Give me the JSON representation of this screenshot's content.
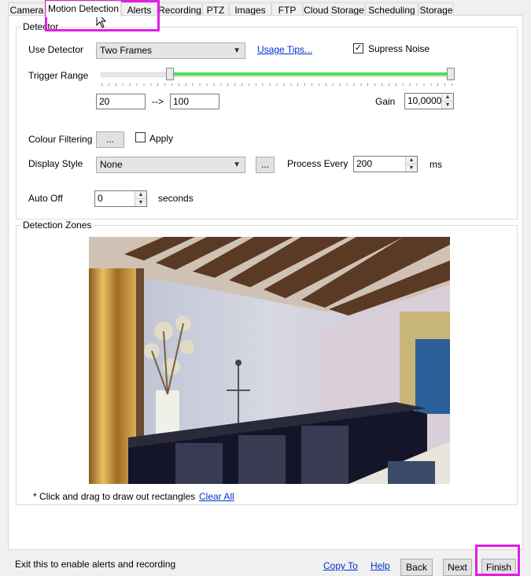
{
  "tabs": [
    "Camera",
    "Motion Detection",
    "Alerts",
    "Recording",
    "PTZ",
    "Images",
    "FTP",
    "Cloud Storage",
    "Scheduling",
    "Storage"
  ],
  "detector": {
    "group_title": "Detector",
    "use_detector_label": "Use Detector",
    "use_detector_value": "Two Frames",
    "usage_tips": "Usage Tips...",
    "supress_noise_label": "Supress Noise",
    "supress_noise_checked": true,
    "trigger_range_label": "Trigger Range",
    "trigger_low": "20",
    "arrow": "-->",
    "trigger_high": "100",
    "gain_label": "Gain",
    "gain_value": "10,00000",
    "colour_filtering_label": "Colour Filtering",
    "ellipsis": "...",
    "apply_label": "Apply",
    "apply_checked": false,
    "display_style_label": "Display Style",
    "display_style_value": "None",
    "process_every_label": "Process Every",
    "process_every_value": "200",
    "ms_label": "ms",
    "auto_off_label": "Auto Off",
    "auto_off_value": "0",
    "seconds_label": "seconds"
  },
  "zones": {
    "group_title": "Detection Zones",
    "hint": "* Click and drag to draw out rectangles",
    "clear_all": "Clear All"
  },
  "footer": {
    "status": "Exit this to enable alerts and recording",
    "copy_to": "Copy To",
    "help": "Help",
    "back": "Back",
    "next": "Next",
    "finish": "Finish"
  },
  "colors": {
    "highlight": "#e020e0",
    "slider_range": "#4fe04f",
    "link": "#0033cc"
  }
}
